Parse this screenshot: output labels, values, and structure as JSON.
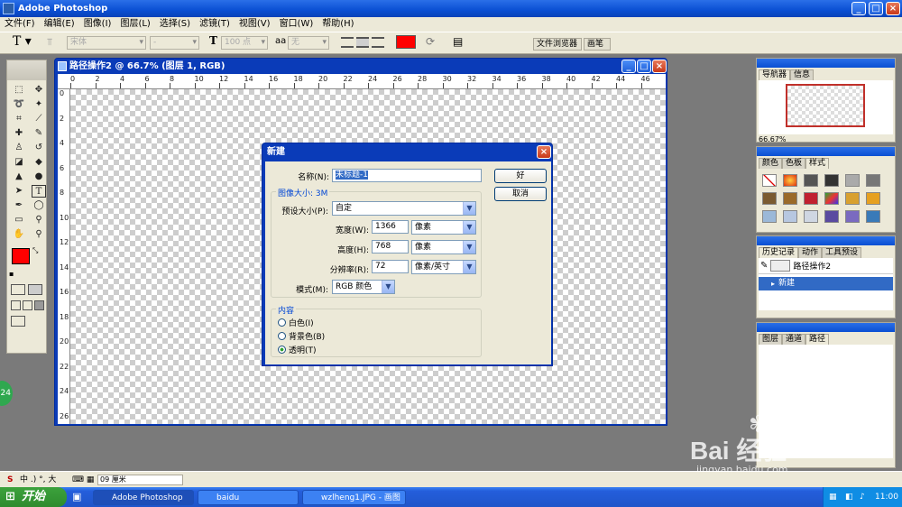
{
  "app": {
    "title": "Adobe Photoshop"
  },
  "menu": [
    "文件(F)",
    "编辑(E)",
    "图像(I)",
    "图层(L)",
    "选择(S)",
    "滤镜(T)",
    "视图(V)",
    "窗口(W)",
    "帮助(H)"
  ],
  "options": {
    "font_family": "宋体",
    "font_style": "-",
    "font_size": "100 点",
    "aa": "无",
    "text_color": "#ff0000"
  },
  "wells": {
    "file_browser": "文件浏览器",
    "brushes": "画笔"
  },
  "document": {
    "title": "路径操作2 @ 66.7% (图层 1, RGB)",
    "ruler_h": [
      "0",
      "2",
      "4",
      "6",
      "8",
      "10",
      "12",
      "14",
      "16",
      "18",
      "20",
      "22",
      "24",
      "26",
      "28",
      "30",
      "32",
      "34",
      "36",
      "38",
      "40",
      "42",
      "44",
      "46"
    ],
    "ruler_v": [
      "0",
      "2",
      "4",
      "6",
      "8",
      "10",
      "12",
      "14",
      "16",
      "18",
      "20",
      "22",
      "24",
      "26"
    ]
  },
  "dialog": {
    "title": "新建",
    "name_label": "名称(N):",
    "name_value": "未标题-1",
    "ok": "好",
    "cancel": "取消",
    "size_group": "图像大小: 3M",
    "preset_label": "预设大小(P):",
    "preset_value": "自定",
    "width_label": "宽度(W):",
    "width_value": "1366",
    "width_unit": "像素",
    "height_label": "高度(H):",
    "height_value": "768",
    "height_unit": "像素",
    "res_label": "分辨率(R):",
    "res_value": "72",
    "res_unit": "像素/英寸",
    "mode_label": "模式(M):",
    "mode_value": "RGB 颜色",
    "content_group": "内容",
    "content_options": [
      "白色(I)",
      "背景色(B)",
      "透明(T)"
    ],
    "content_selected": 2
  },
  "navigator": {
    "tabs": [
      "导航器",
      "信息"
    ],
    "zoom": "66.67%"
  },
  "color_panel": {
    "tabs": [
      "颜色",
      "色板",
      "样式"
    ]
  },
  "history": {
    "tabs": [
      "历史记录",
      "动作",
      "工具预设"
    ],
    "snapshot": "路径操作2",
    "items": [
      "新建"
    ]
  },
  "layers": {
    "tabs": [
      "图层",
      "通道",
      "路径"
    ]
  },
  "status": {
    "zoom": "09 厘米",
    "ime": "中 .) °, 大"
  },
  "taskbar": {
    "start": "开始",
    "tasks": [
      "Adobe Photoshop",
      "baidu",
      "wzlheng1.JPG - 画图"
    ],
    "time": "11:00"
  },
  "watermark": {
    "brand": "Bai 经验",
    "url": "jingyan.baidu.com"
  },
  "side_badge": "24",
  "colors": {
    "fg": "#ff0000",
    "bg": "#0000ff",
    "xp_blue": "#0a3bb8"
  }
}
